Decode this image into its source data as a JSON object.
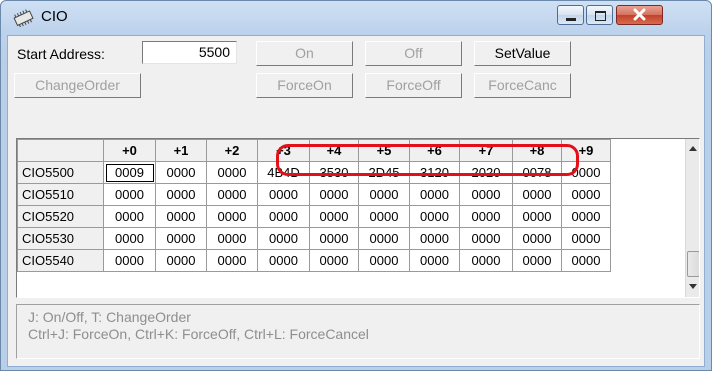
{
  "window": {
    "title": "CIO",
    "icon": "chip-icon"
  },
  "controls": {
    "start_address_label": "Start Address:",
    "start_address_value": "5500",
    "on_label": "On",
    "off_label": "Off",
    "setvalue_label": "SetValue",
    "changeorder_label": "ChangeOrder",
    "forceon_label": "ForceOn",
    "forceoff_label": "ForceOff",
    "forcecanc_label": "ForceCanc"
  },
  "grid": {
    "columns": [
      "",
      "+0",
      "+1",
      "+2",
      "+3",
      "+4",
      "+5",
      "+6",
      "+7",
      "+8",
      "+9"
    ],
    "rows": [
      {
        "address": "CIO5500",
        "values": [
          "0009",
          "0000",
          "0000",
          "4B4D",
          "3530",
          "2D45",
          "3120",
          "2020",
          "0078",
          "0000"
        ]
      },
      {
        "address": "CIO5510",
        "values": [
          "0000",
          "0000",
          "0000",
          "0000",
          "0000",
          "0000",
          "0000",
          "0000",
          "0000",
          "0000"
        ]
      },
      {
        "address": "CIO5520",
        "values": [
          "0000",
          "0000",
          "0000",
          "0000",
          "0000",
          "0000",
          "0000",
          "0000",
          "0000",
          "0000"
        ]
      },
      {
        "address": "CIO5530",
        "values": [
          "0000",
          "0000",
          "0000",
          "0000",
          "0000",
          "0000",
          "0000",
          "0000",
          "0000",
          "0000"
        ]
      },
      {
        "address": "CIO5540",
        "values": [
          "0000",
          "0000",
          "0000",
          "0000",
          "0000",
          "0000",
          "0000",
          "0000",
          "0000",
          "0000"
        ]
      }
    ]
  },
  "help": {
    "line1": "J: On/Off,   T: ChangeOrder",
    "line2": "Ctrl+J: ForceOn,   Ctrl+K: ForceOff,   Ctrl+L: ForceCancel"
  },
  "colors": {
    "highlight": "#e3101a",
    "close_button": "#c3412b"
  }
}
